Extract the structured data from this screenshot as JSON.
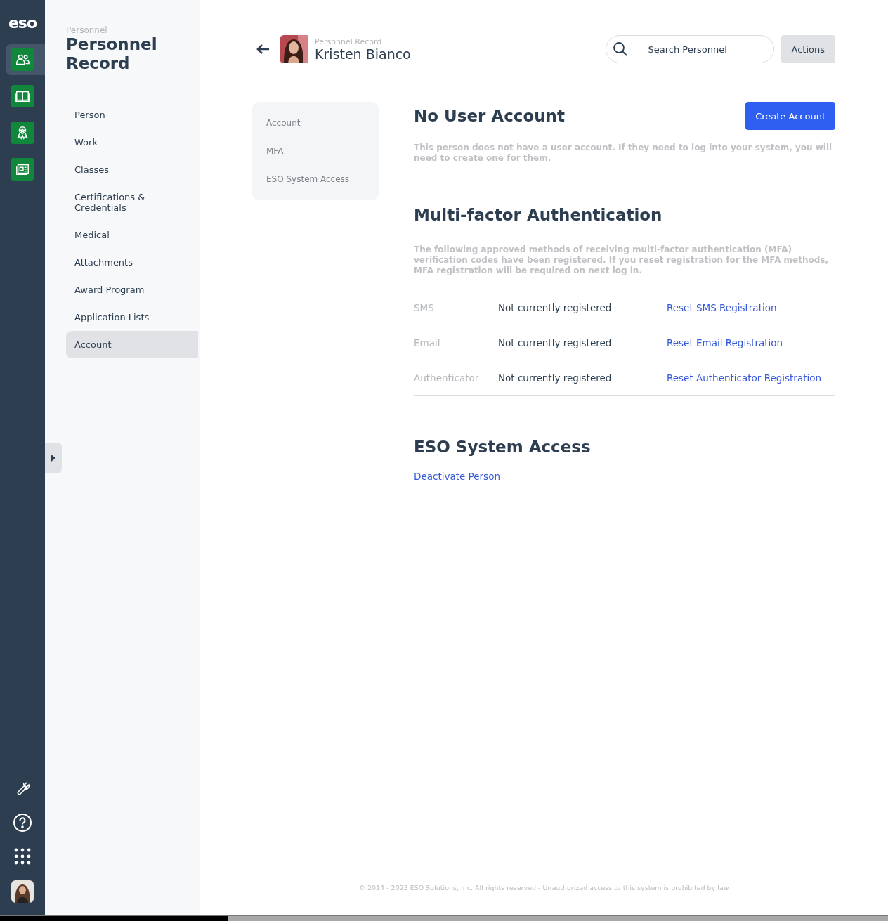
{
  "rail": {
    "logo": "eso",
    "apps": [
      {
        "kind": "people",
        "selected": true
      },
      {
        "kind": "book",
        "selected": false
      },
      {
        "kind": "award",
        "selected": false
      },
      {
        "kind": "news",
        "selected": false
      }
    ]
  },
  "sidebar": {
    "eyebrow": "Personnel",
    "title": "Personnel Record",
    "items": [
      {
        "label": "Person",
        "selected": false
      },
      {
        "label": "Work",
        "selected": false
      },
      {
        "label": "Classes",
        "selected": false
      },
      {
        "label": "Certifications & Credentials",
        "selected": false
      },
      {
        "label": "Medical",
        "selected": false
      },
      {
        "label": "Attachments",
        "selected": false
      },
      {
        "label": "Award Program",
        "selected": false
      },
      {
        "label": "Application Lists",
        "selected": false
      },
      {
        "label": "Account",
        "selected": true
      }
    ]
  },
  "header": {
    "eyebrow": "Personnel Record",
    "name": "Kristen Bianco",
    "search": {
      "placeholder": "Search Personnel"
    },
    "actions": "Actions"
  },
  "section_nav": [
    "Account",
    "MFA",
    "ESO System Access"
  ],
  "account": {
    "title": "No User Account",
    "button": "Create Account",
    "description": "This person does not have a user account. If they need to log into your system, you will need to create one for them."
  },
  "mfa": {
    "title": "Multi-factor Authentication",
    "description": "The following approved methods of receiving multi-factor authentication (MFA) verification codes have been registered. If you reset registration for the MFA methods, MFA registration will be required on next log in.",
    "methods": [
      {
        "name": "SMS",
        "status": "Not currently registered",
        "action": "Reset SMS Registration"
      },
      {
        "name": "Email",
        "status": "Not currently registered",
        "action": "Reset Email Registration"
      },
      {
        "name": "Authenticator",
        "status": "Not currently registered",
        "action": "Reset Authenticator Registration"
      }
    ]
  },
  "access": {
    "title": "ESO System Access",
    "link": "Deactivate Person"
  },
  "footer": "© 2014 - 2023 ESO Solutions, Inc. All rights reserved - Unauthorized access to this system is prohibited by law"
}
